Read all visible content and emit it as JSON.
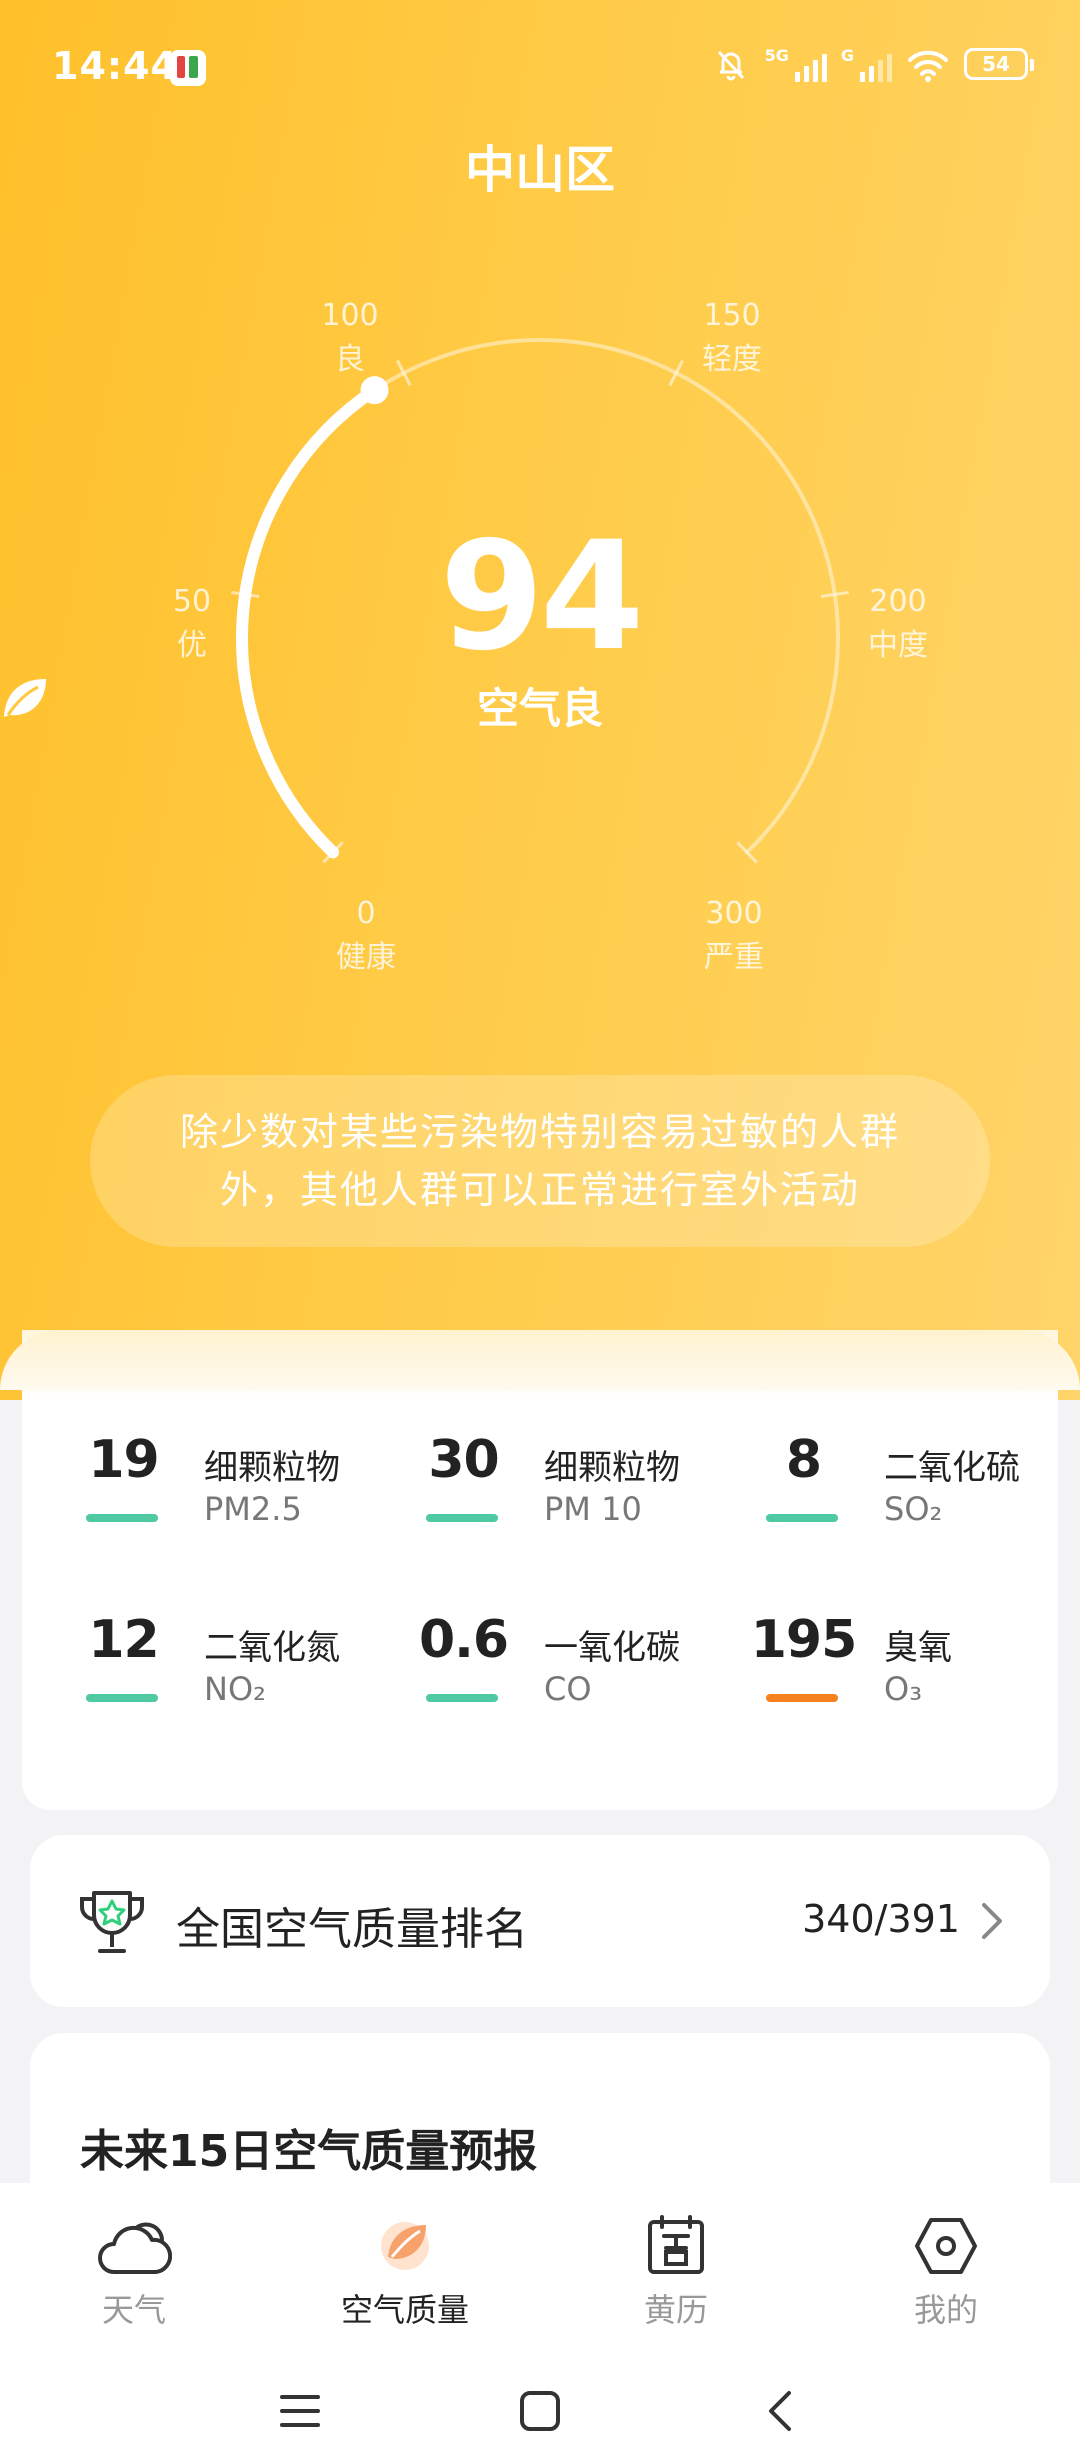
{
  "status": {
    "time": "14:44",
    "network1": "5G",
    "network2": "G",
    "battery": "54"
  },
  "title": "中山区",
  "gauge": {
    "value": "94",
    "level": "空气良",
    "value_num": 94,
    "ticks": [
      {
        "value": "0",
        "label": "健康"
      },
      {
        "value": "50",
        "label": "优"
      },
      {
        "value": "100",
        "label": "良"
      },
      {
        "value": "150",
        "label": "轻度"
      },
      {
        "value": "200",
        "label": "中度"
      },
      {
        "value": "300",
        "label": "严重"
      }
    ]
  },
  "advice": "除少数对某些污染物特别容易过敏的人群外，其他人群可以正常进行室外活动",
  "pollutants": [
    {
      "value": "19",
      "name": "细颗粒物",
      "code": "PM2.5",
      "color": "#4ec9a1"
    },
    {
      "value": "30",
      "name": "细颗粒物",
      "code": "PM 10",
      "color": "#4ec9a1"
    },
    {
      "value": "8",
      "name": "二氧化硫",
      "code": "SO₂",
      "color": "#4ec9a1"
    },
    {
      "value": "12",
      "name": "二氧化氮",
      "code": "NO₂",
      "color": "#4ec9a1"
    },
    {
      "value": "0.6",
      "name": "一氧化碳",
      "code": "CO",
      "color": "#4ec9a1"
    },
    {
      "value": "195",
      "name": "臭氧",
      "code": "O₃",
      "color": "#f5821f"
    }
  ],
  "ranking": {
    "label": "全国空气质量排名",
    "value": "340/391"
  },
  "forecast": {
    "label": "未来15日空气质量预报"
  },
  "nav": [
    {
      "label": "天气",
      "icon": "cloud-icon"
    },
    {
      "label": "空气质量",
      "icon": "air-quality-icon"
    },
    {
      "label": "黄历",
      "icon": "calendar-icon"
    },
    {
      "label": "我的",
      "icon": "hexagon-settings-icon"
    }
  ],
  "colors": {
    "hero_start": "#ffc02a",
    "hero_end": "#ffd46a",
    "good": "#4ec9a1",
    "warning": "#f5821f"
  }
}
